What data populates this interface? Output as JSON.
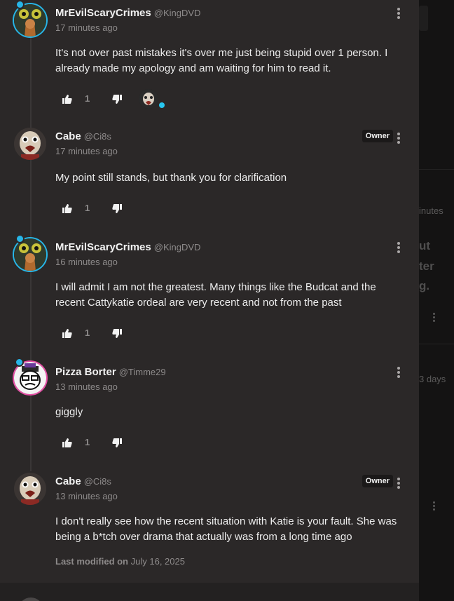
{
  "background_page": {
    "texts": [
      "inutes",
      "ut",
      "ter",
      "g.",
      "3 days"
    ]
  },
  "comments": [
    {
      "name": "MrEvilScaryCrimes",
      "handle": "@KingDVD",
      "time": "17 minutes ago",
      "text": "It's not over past mistakes it's over me just being stupid over 1 person. I already made my apology and am waiting for him to read it.",
      "likes": "1",
      "avatar": "turtle-avatar"
    },
    {
      "name": "Cabe",
      "handle": "@Ci8s",
      "owner_label": "Owner",
      "time": "17 minutes ago",
      "text": "My point still stands, but thank you for clarification",
      "likes": "1",
      "avatar": "bird-avatar"
    },
    {
      "name": "MrEvilScaryCrimes",
      "handle": "@KingDVD",
      "time": "16 minutes ago",
      "text": "I will admit I am not the greatest. Many things like the Budcat and the recent Cattykatie ordeal are very recent and not from the past",
      "likes": "1",
      "avatar": "turtle-avatar"
    },
    {
      "name": "Pizza Borter",
      "handle": "@Timme29",
      "time": "13 minutes ago",
      "text": "giggly",
      "likes": "1",
      "avatar": "cartoon-avatar"
    },
    {
      "name": "Cabe",
      "handle": "@Ci8s",
      "owner_label": "Owner",
      "time": "13 minutes ago",
      "text": "I don't really see how the recent situation with Katie is your fault. She was being a b*tch over drama that actually was from a long time ago",
      "last_modified_label": "Last modified on",
      "last_modified_date": "July 16, 2025",
      "avatar": "bird-avatar"
    }
  ],
  "colors": {
    "panel": "#2b2828",
    "ring": "#27b6e8",
    "ring_pink": "#e64fa6"
  }
}
